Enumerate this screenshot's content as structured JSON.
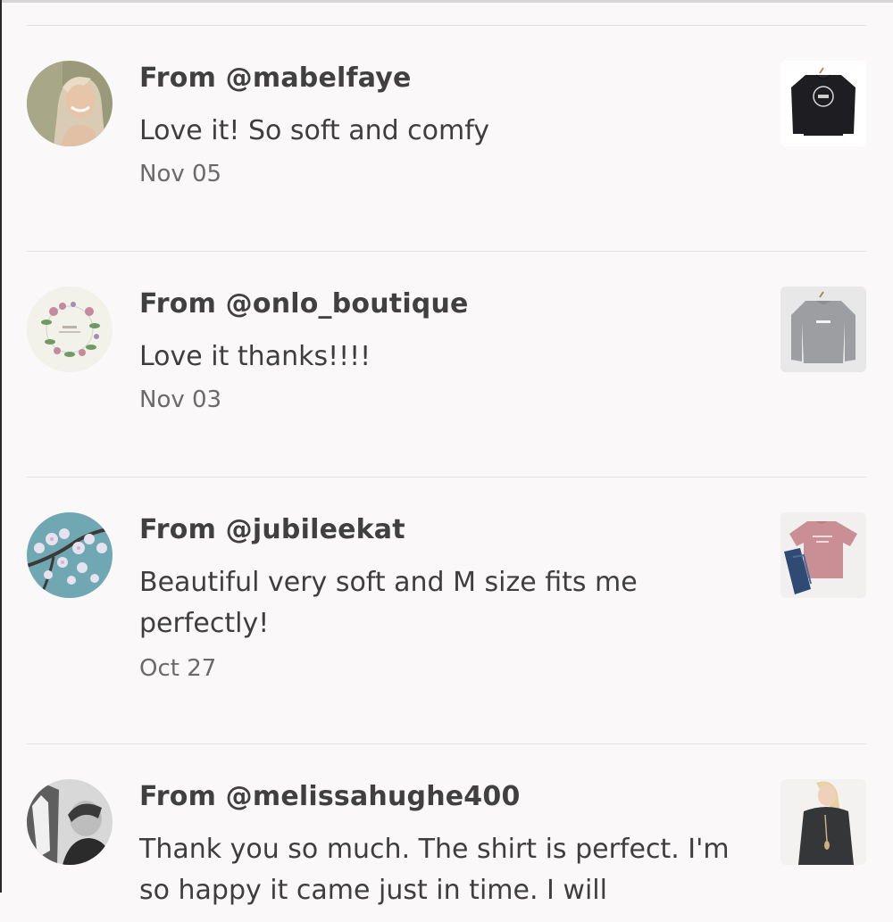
{
  "reviews": [
    {
      "author": "From @mabelfaye",
      "message": "Love it! So soft and comfy",
      "date": "Nov 05",
      "avatar_icon": "user-photo-woman-blonde",
      "product_icon": "black-sweatshirt"
    },
    {
      "author": "From @onlo_boutique",
      "message": "Love it thanks!!!!",
      "date": "Nov 03",
      "avatar_icon": "boutique-floral-wreath-logo",
      "product_icon": "gray-sweatshirt"
    },
    {
      "author": "From @jubileekat",
      "message": "Beautiful very soft and M size fits me perfectly!",
      "date": "Oct 27",
      "avatar_icon": "cherry-blossom-photo",
      "product_icon": "pink-tshirt-with-jeans"
    },
    {
      "author": "From @melissahughe400",
      "message": "Thank you so much. The shirt is perfect. I'm so happy it came just in time. I will",
      "date": "",
      "avatar_icon": "user-photo-woman-with-horse",
      "product_icon": "dark-longsleeve-top-on-model"
    }
  ]
}
